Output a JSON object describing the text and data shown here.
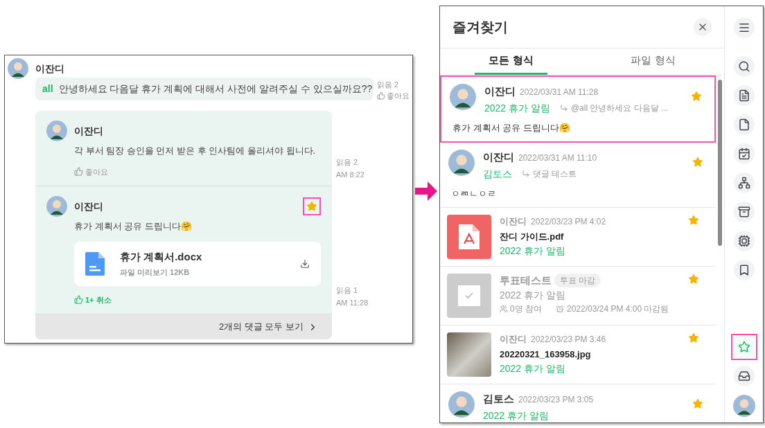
{
  "thread": {
    "post": {
      "author": "이잔디",
      "mention": "all",
      "text": "안녕하세요 다음달 휴가 계획에 대해서 사전에 알려주실 수 있으실까요??",
      "read": "읽음 2",
      "like": "좋아요"
    },
    "replies": [
      {
        "author": "이잔디",
        "text": "각 부서 팀장 승인을 먼저 받은 후 인사팀에 올리셔야 됩니다.",
        "like": {
          "label": "좋아요",
          "liked": false
        },
        "read": "읽음 2",
        "time": "AM 8:22",
        "starred": false,
        "highlighted": false
      },
      {
        "author": "이잔디",
        "text": "휴가 계획서 공유 드립니다🤗",
        "file": {
          "name": "휴가 계획서.docx",
          "meta": "파일 미리보기 12KB"
        },
        "like": {
          "label": "1+ 취소",
          "liked": true
        },
        "read": "읽음 1",
        "time": "AM 11:28",
        "starred": true,
        "highlighted": true
      }
    ],
    "more_comments": "2개의 댓글 모두 보기"
  },
  "favorites": {
    "title": "즐겨찾기",
    "tabs": [
      {
        "label": "모든 형식",
        "selected": true
      },
      {
        "label": "파일 형식",
        "selected": false
      }
    ],
    "items": [
      {
        "kind": "message",
        "author": "이잔디",
        "date": "2022/03/31 AM 11:28",
        "topic": "2022 휴가 알림",
        "quote": "@all 안녕하세요 다음달 ...",
        "text": "휴가 계획서 공유 드립니다🤗",
        "starred": true,
        "highlighted": true
      },
      {
        "kind": "message",
        "author": "이잔디",
        "date": "2022/03/31 AM 11:10",
        "topic": "김토스",
        "quote": "댓글 테스트",
        "text": "ㅇㄻㄴㅇㄹ",
        "starred": true,
        "highlighted": false
      },
      {
        "kind": "file",
        "author": "이잔디",
        "date": "2022/03/23 PM 4:02",
        "name": "잔디 가이드.pdf",
        "topic": "2022 휴가 알림",
        "starred": true
      },
      {
        "kind": "poll",
        "title": "투표테스트",
        "status": "투표 마감",
        "topic": "2022 휴가 알림",
        "participants": "0명 참여",
        "deadline": "2022/03/24 PM 4:00 마감됨",
        "starred": true
      },
      {
        "kind": "image",
        "author": "이잔디",
        "date": "2022/03/23 PM 3:46",
        "name": "20220321_163958.jpg",
        "topic": "2022 휴가 알림",
        "starred": true
      },
      {
        "kind": "message",
        "author": "김토스",
        "date": "2022/03/23 PM 3:05",
        "topic": "2022 휴가 알림",
        "starred": true,
        "highlighted": false
      }
    ]
  },
  "rail": [
    {
      "selected": false,
      "highlighted": false
    },
    {
      "selected": false,
      "highlighted": false
    },
    {
      "selected": false,
      "highlighted": false
    },
    {
      "selected": false,
      "highlighted": false
    },
    {
      "selected": false,
      "highlighted": false
    },
    {
      "selected": false,
      "highlighted": false
    },
    {
      "selected": false,
      "highlighted": false
    },
    {
      "selected": false,
      "highlighted": false
    },
    {
      "selected": false,
      "highlighted": false
    },
    {
      "selected": true,
      "highlighted": true
    },
    {
      "selected": false,
      "highlighted": false
    }
  ]
}
